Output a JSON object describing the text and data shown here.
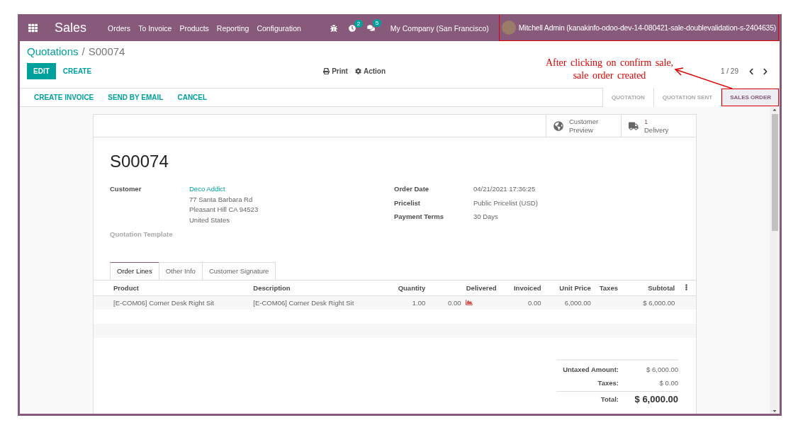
{
  "navbar": {
    "app_name": "Sales",
    "menu": [
      "Orders",
      "To Invoice",
      "Products",
      "Reporting",
      "Configuration"
    ],
    "activity_count": "2",
    "message_count": "5",
    "company": "My Company (San Francisco)",
    "user": {
      "name": "Mitchell Admin (kanakinfo-odoo-dev-14-080421-sale-doublevalidation-s-2404635)",
      "highlighted": true
    }
  },
  "breadcrumb": {
    "parent": "Quotations",
    "separator": "/",
    "current": "S00074"
  },
  "buttons": {
    "edit": "EDIT",
    "create": "CREATE",
    "print": "Print",
    "action": "Action"
  },
  "pager": {
    "value": "1 / 29"
  },
  "annotation": {
    "text": "After clicking on confirm sale,\nsale order created"
  },
  "header_buttons": [
    "CREATE INVOICE",
    "SEND BY EMAIL",
    "CANCEL"
  ],
  "stages": [
    {
      "label": "QUOTATION",
      "selected": false,
      "highlighted": false
    },
    {
      "label": "QUOTATION SENT",
      "selected": false,
      "highlighted": false
    },
    {
      "label": "SALES ORDER",
      "selected": true,
      "highlighted": true
    }
  ],
  "stat_buttons": [
    {
      "kind": "preview",
      "lines": [
        "Customer",
        "Preview"
      ]
    },
    {
      "kind": "delivery",
      "lines": [
        "1",
        "Delivery"
      ]
    }
  ],
  "title": "S00074",
  "left_fields": [
    {
      "label": "Customer",
      "kind": "link",
      "values": [
        "Deco Addict",
        "77 Santa Barbara Rd",
        "Pleasant Hill CA 94523",
        "United States"
      ]
    },
    {
      "label": "Quotation Template",
      "kind": "empty"
    }
  ],
  "right_fields": [
    {
      "label": "Order Date",
      "values": [
        "04/21/2021 17:36:25"
      ]
    },
    {
      "label": "Pricelist",
      "values": [
        "Public Pricelist (USD)"
      ]
    },
    {
      "label": "Payment Terms",
      "values": [
        "30 Days"
      ]
    }
  ],
  "tabs": [
    {
      "label": "Order Lines",
      "selected": true
    },
    {
      "label": "Other Info",
      "selected": false
    },
    {
      "label": "Customer Signature",
      "selected": false
    }
  ],
  "table": {
    "columns": [
      "Product",
      "Description",
      "Quantity",
      "Delivered",
      "Invoiced",
      "Unit Price",
      "Taxes",
      "Subtotal"
    ],
    "rows": [
      [
        "[E-COM06] Corner Desk Right Sit",
        "[E-COM06] Corner Desk Right Sit",
        "1.00",
        "0.00",
        "0.00",
        "6,000.00",
        "",
        "$ 6,000.00"
      ]
    ]
  },
  "totals": [
    {
      "label": "Untaxed Amount:",
      "value": "$ 6,000.00",
      "kind": "normal"
    },
    {
      "label": "Taxes:",
      "value": "$ 0.00",
      "kind": "normal"
    },
    {
      "label": "Total:",
      "value": "$ 6,000.00",
      "kind": "grand"
    }
  ]
}
